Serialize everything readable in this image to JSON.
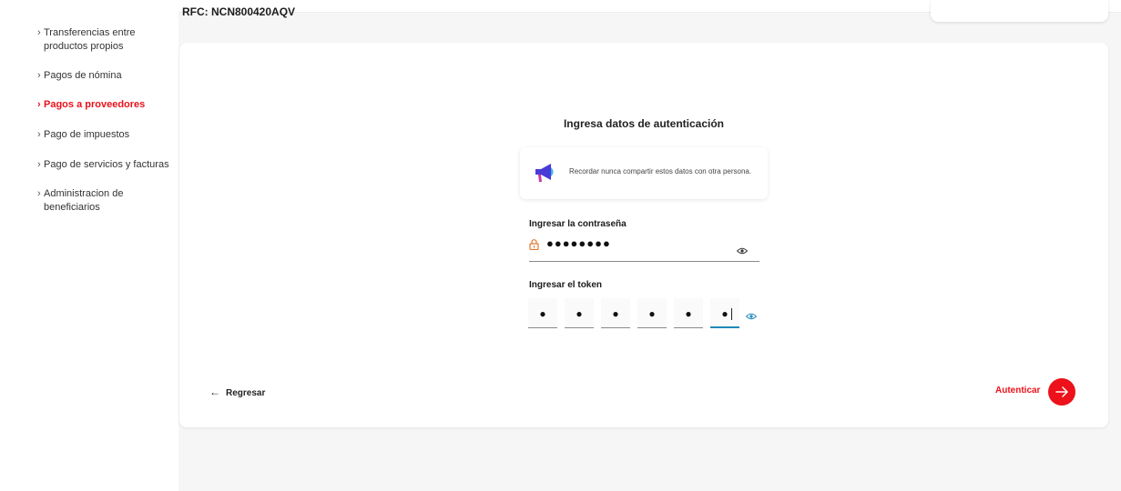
{
  "sidebar": {
    "items": [
      {
        "label_line1": "Transferencias entre",
        "label_line2": "productos propios"
      },
      {
        "label": "Pagos de nómina"
      },
      {
        "label": "Pagos a proveedores"
      },
      {
        "label": "Pago de impuestos"
      },
      {
        "label": "Pago de servicios y facturas"
      },
      {
        "label_line1": "Administracion de",
        "label_line2": "beneficiarios"
      }
    ],
    "active": "Pagos a proveedores"
  },
  "header": {
    "rfc": "RFC: NCN800420AQV"
  },
  "auth": {
    "title": "Ingresa datos de autenticación",
    "notice": "Recordar nunca compartir estos datos con otra persona.",
    "password_label": "Ingresar la contraseña",
    "password_value": "●●●●●●●●",
    "token_label": "Ingresar el token",
    "token_digits": [
      "●",
      "●",
      "●",
      "●",
      "●",
      "●"
    ],
    "back_label": "Regresar",
    "submit_label": "Autenticar"
  },
  "icons": {
    "chevron": "chevron-right-icon",
    "notice": "megaphone-icon",
    "lock": "lock-icon",
    "eye": "eye-icon",
    "back": "arrow-left-icon",
    "submit": "arrow-right-icon"
  },
  "colors": {
    "accent": "#ec111a",
    "token_focus": "#1e88b8",
    "megaphone": "#4a3bd6"
  }
}
